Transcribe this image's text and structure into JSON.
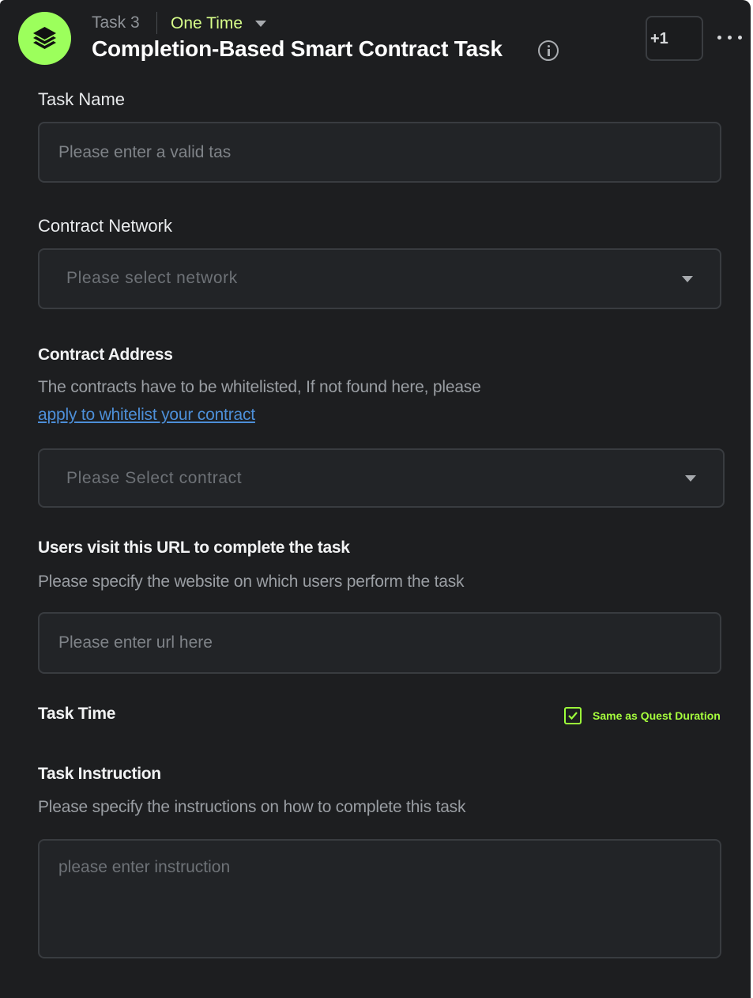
{
  "header": {
    "task_number": "Task 3",
    "task_type": "One Time",
    "title": "Completion-Based Smart Contract Task",
    "count_badge": "+1",
    "brand_color": "#9cff5c",
    "logo_icon": "stack-layers-icon"
  },
  "form": {
    "task_name": {
      "label": "Task Name",
      "placeholder": "Please enter a valid tas",
      "value": ""
    },
    "network": {
      "label": "Contract Network",
      "placeholder": "Please select network"
    },
    "contract": {
      "label": "Contract Address",
      "helper": "The contracts have to be whitelisted, If not found here, please",
      "link_text": "apply to whitelist your contract",
      "placeholder": "Please Select contract"
    },
    "url": {
      "label": "Users visit this URL to complete the task",
      "helper": "Please specify the website on which users perform the task",
      "placeholder": "Please enter url here",
      "value": ""
    },
    "task_time": {
      "label": "Task Time",
      "checkbox_label": "Same as Quest Duration",
      "checked": true
    },
    "instruction": {
      "label": "Task Instruction",
      "helper": "Please specify the instructions on how to complete this task",
      "placeholder": "please enter instruction",
      "value": ""
    }
  }
}
